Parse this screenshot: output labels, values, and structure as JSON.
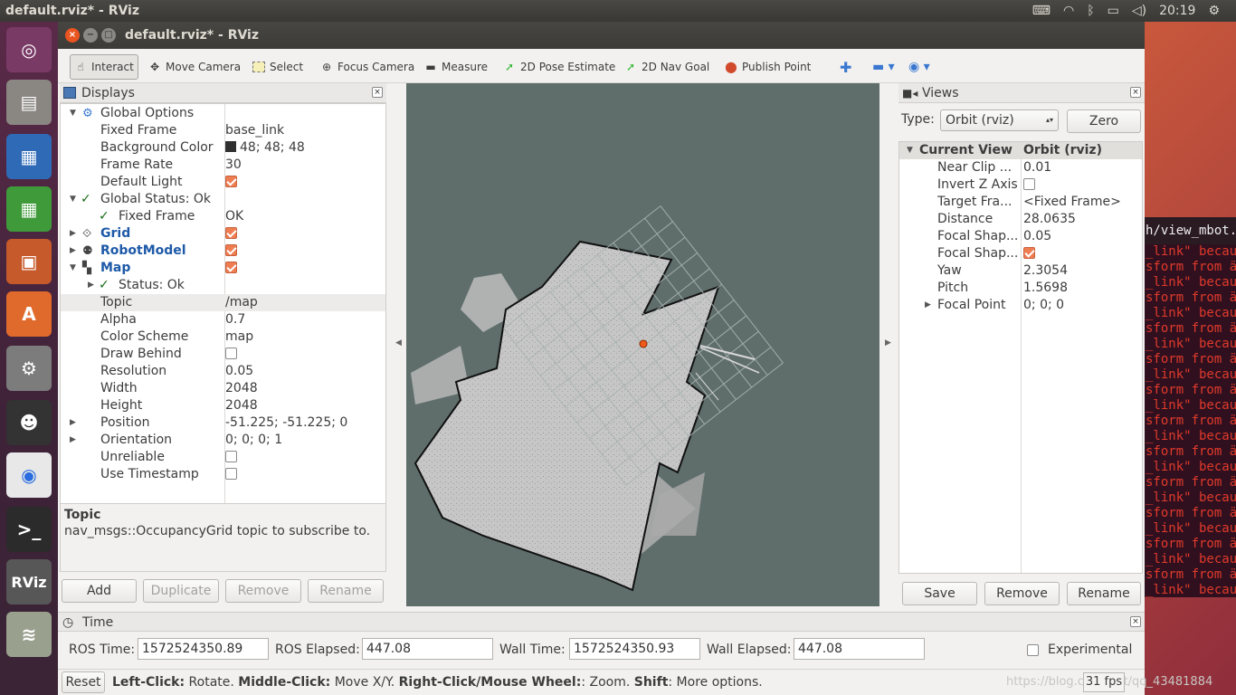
{
  "desktop": {
    "title": "default.rviz* - RViz",
    "clock": "20:19",
    "tray_icons": [
      "keyboard-icon",
      "wifi-icon",
      "bluetooth-icon",
      "battery-icon",
      "volume-icon",
      "settings-gear-icon"
    ]
  },
  "window": {
    "title": "default.rviz* - RViz"
  },
  "toolbar": {
    "interact": "Interact",
    "move_camera": "Move Camera",
    "select": "Select",
    "focus_camera": "Focus Camera",
    "measure": "Measure",
    "pose_estimate": "2D Pose Estimate",
    "nav_goal": "2D Nav Goal",
    "publish_point": "Publish Point"
  },
  "displays": {
    "title": "Displays",
    "rows": [
      {
        "k": "Global Options",
        "v": ""
      },
      {
        "k": "Fixed Frame",
        "v": "base_link"
      },
      {
        "k": "Background Color",
        "v": "48; 48; 48"
      },
      {
        "k": "Frame Rate",
        "v": "30"
      },
      {
        "k": "Default Light",
        "v": ""
      },
      {
        "k": "Global Status: Ok",
        "v": ""
      },
      {
        "k": "Fixed Frame",
        "v": "OK"
      },
      {
        "k": "Grid",
        "v": ""
      },
      {
        "k": "RobotModel",
        "v": ""
      },
      {
        "k": "Map",
        "v": ""
      },
      {
        "k": "Status: Ok",
        "v": ""
      },
      {
        "k": "Topic",
        "v": "/map"
      },
      {
        "k": "Alpha",
        "v": "0.7"
      },
      {
        "k": "Color Scheme",
        "v": "map"
      },
      {
        "k": "Draw Behind",
        "v": ""
      },
      {
        "k": "Resolution",
        "v": "0.05"
      },
      {
        "k": "Width",
        "v": "2048"
      },
      {
        "k": "Height",
        "v": "2048"
      },
      {
        "k": "Position",
        "v": "-51.225; -51.225; 0"
      },
      {
        "k": "Orientation",
        "v": "0; 0; 0; 1"
      },
      {
        "k": "Unreliable",
        "v": ""
      },
      {
        "k": "Use Timestamp",
        "v": ""
      }
    ],
    "background_color_hex": "#303030",
    "checked": {
      "default_light": true,
      "grid": true,
      "robotmodel": true,
      "map": true,
      "draw_behind": false,
      "unreliable": false,
      "use_timestamp": false
    },
    "desc_title": "Topic",
    "desc_text": "nav_msgs::OccupancyGrid topic to subscribe to.",
    "buttons": {
      "add": "Add",
      "duplicate": "Duplicate",
      "remove": "Remove",
      "rename": "Rename"
    }
  },
  "views": {
    "title": "Views",
    "type_label": "Type:",
    "type_value": "Orbit (rviz)",
    "zero": "Zero",
    "header_k": "Current View",
    "header_v": "Orbit (rviz)",
    "rows": [
      {
        "k": "Near Clip ...",
        "v": "0.01"
      },
      {
        "k": "Invert Z Axis",
        "v": ""
      },
      {
        "k": "Target Fra...",
        "v": "<Fixed Frame>"
      },
      {
        "k": "Distance",
        "v": "28.0635"
      },
      {
        "k": "Focal Shap...",
        "v": "0.05"
      },
      {
        "k": "Focal Shap...",
        "v": ""
      },
      {
        "k": "Yaw",
        "v": "2.3054"
      },
      {
        "k": "Pitch",
        "v": "1.5698"
      },
      {
        "k": "Focal Point",
        "v": "0; 0; 0"
      }
    ],
    "buttons": {
      "save": "Save",
      "remove": "Remove",
      "rename": "Rename"
    }
  },
  "time": {
    "title": "Time",
    "ros_time_label": "ROS Time:",
    "ros_time": "1572524350.89",
    "ros_elapsed_label": "ROS Elapsed:",
    "ros_elapsed": "447.08",
    "wall_time_label": "Wall Time:",
    "wall_time": "1572524350.93",
    "wall_elapsed_label": "Wall Elapsed:",
    "wall_elapsed": "447.08",
    "experimental": "Experimental"
  },
  "status": {
    "reset": "Reset",
    "left_click_k": "Left-Click:",
    "left_click_v": " Rotate. ",
    "middle_click_k": "Middle-Click:",
    "middle_click_v": " Move X/Y. ",
    "right_click_k": "Right-Click/Mouse Wheel:",
    "right_click_v": ": Zoom. ",
    "shift_k": "Shift",
    "shift_v": ": More options.",
    "fps": "31 fps",
    "watermark": "https://blog.csdn.net/qq_43481884"
  },
  "terminal": {
    "header": "h/view_mbot.l",
    "lines": [
      "_link\" becau",
      "sform from ä",
      "_link\" becau",
      "sform from ä",
      "_link\" becau",
      "sform from ä",
      "_link\" becau",
      "sform from ä",
      "_link\" becau",
      "sform from ä",
      "_link\" becau",
      "sform from ä",
      "_link\" becau",
      "sform from ä",
      "_link\" becau",
      "sform from ä",
      "_link\" becau",
      "sform from ä",
      "_link\" becau",
      "sform from ä",
      "_link\" becau",
      "sform from ä",
      "_link\" becau"
    ]
  }
}
